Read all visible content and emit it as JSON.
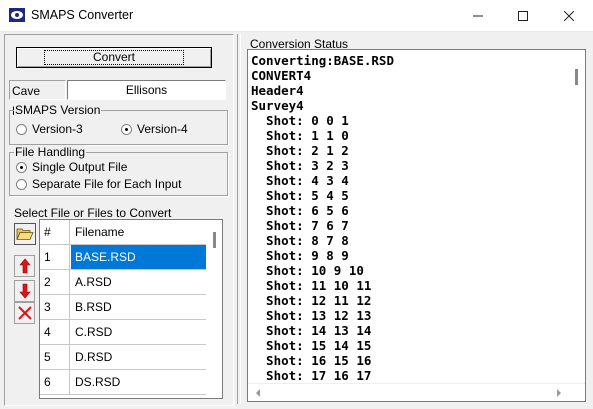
{
  "window": {
    "title": "SMAPS Converter",
    "minimize_glyph": "—",
    "maximize_glyph": "☐",
    "close_glyph": "✕"
  },
  "left": {
    "convert_label": "Convert",
    "cave_name_label": "Cave Name",
    "cave_name_value": "Ellisons",
    "smaps_version": {
      "title": "SMAPS Version",
      "options": [
        "Version-3",
        "Version-4"
      ],
      "selected": "Version-4"
    },
    "file_handling": {
      "title": "File Handling",
      "options": [
        "Single Output File",
        "Separate File for Each Input"
      ],
      "selected": "Single Output File"
    },
    "select_label": "Select File or Files to Convert",
    "table": {
      "headers": [
        "#",
        "Filename"
      ],
      "rows": [
        {
          "num": "1",
          "name": "BASE.RSD",
          "selected": true
        },
        {
          "num": "2",
          "name": "A.RSD",
          "selected": false
        },
        {
          "num": "3",
          "name": "B.RSD",
          "selected": false
        },
        {
          "num": "4",
          "name": "C.RSD",
          "selected": false
        },
        {
          "num": "5",
          "name": "D.RSD",
          "selected": false
        },
        {
          "num": "6",
          "name": "DS.RSD",
          "selected": false
        }
      ]
    },
    "icons": [
      "folder-open-icon",
      "arrow-up-icon",
      "arrow-down-icon",
      "delete-x-icon"
    ]
  },
  "right": {
    "status_label": "Conversion Status",
    "log_lines": [
      "Converting:BASE.RSD",
      "CONVERT4",
      "Header4",
      "Survey4",
      "  Shot: 0 0 1",
      "  Shot: 1 1 0",
      "  Shot: 2 1 2",
      "  Shot: 3 2 3",
      "  Shot: 4 3 4",
      "  Shot: 5 4 5",
      "  Shot: 6 5 6",
      "  Shot: 7 6 7",
      "  Shot: 8 7 8",
      "  Shot: 9 8 9",
      "  Shot: 10 9 10",
      "  Shot: 11 10 11",
      "  Shot: 12 11 12",
      "  Shot: 13 12 13",
      "  Shot: 14 13 14",
      "  Shot: 15 14 15",
      "  Shot: 16 15 16",
      "  Shot: 17 16 17"
    ]
  },
  "colors": {
    "selection": "#0078d7",
    "arrow_red": "#e0121a"
  }
}
